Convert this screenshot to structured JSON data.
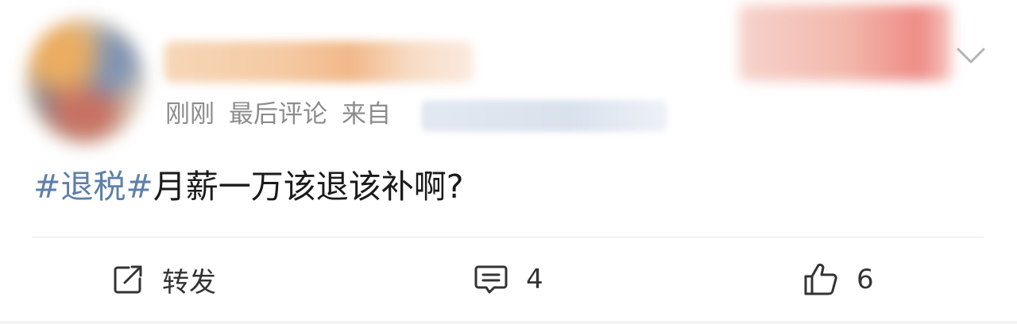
{
  "post": {
    "time": "刚刚",
    "last_comment": "最后评论",
    "from_label": "来自",
    "topic": "#退税#",
    "body": "月薪一万该退该补啊?"
  },
  "actions": {
    "repost_label": "转发",
    "comment_count": "4",
    "like_count": "6"
  },
  "colors": {
    "topic_link": "#5e7fa8",
    "meta_text": "#8c8c8c",
    "body_text": "#1a1a1a"
  },
  "icons": {
    "repost": "share-arrow-icon",
    "comment": "comment-bubble-icon",
    "like": "thumbs-up-icon",
    "more": "chevron-down-icon"
  }
}
